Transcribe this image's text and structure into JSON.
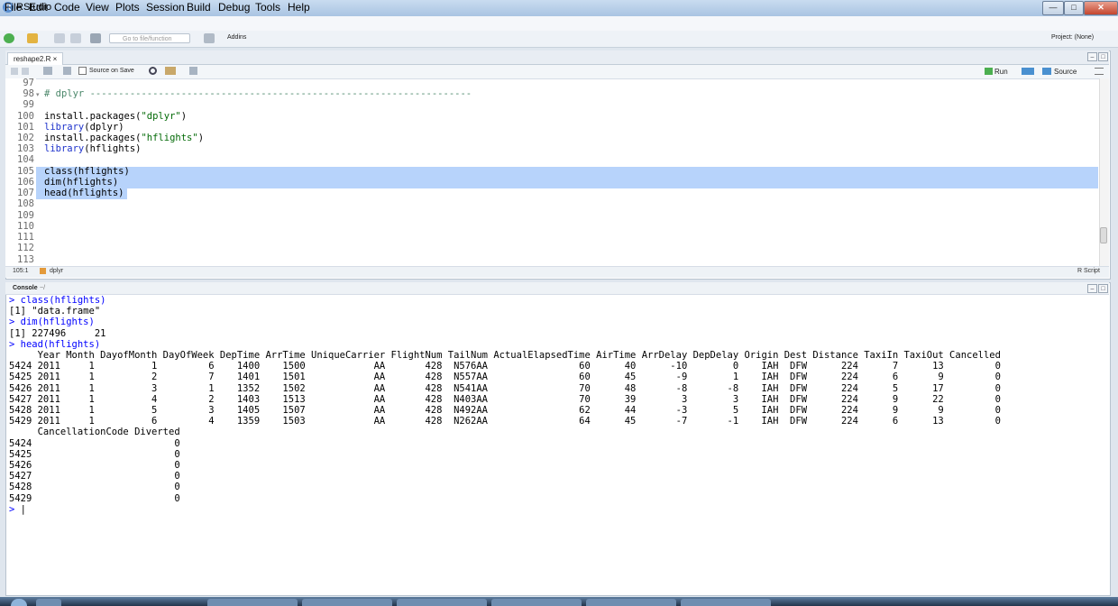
{
  "window": {
    "title": "RStudio"
  },
  "menu": [
    "File",
    "Edit",
    "Code",
    "View",
    "Plots",
    "Session",
    "Build",
    "Debug",
    "Tools",
    "Help"
  ],
  "toolbar": {
    "goto_placeholder": "Go to file/function",
    "addins": "Addins",
    "project": "Project: (None)"
  },
  "editor": {
    "tab": "reshape2.R",
    "source_on_save": "Source on Save",
    "run": "Run",
    "source": "Source",
    "line_numbers": [
      "97",
      "98",
      "99",
      "100",
      "101",
      "102",
      "103",
      "104",
      "105",
      "106",
      "107",
      "108",
      "109",
      "110",
      "111",
      "112",
      "113"
    ],
    "lines": {
      "l98": "# dplyr -------------------------------------------------------------------",
      "l100a": "install.packages(",
      "l100b": "\"dplyr\"",
      "l100c": ")",
      "l101a": "library",
      "l101b": "(dplyr)",
      "l102a": "install.packages(",
      "l102b": "\"hflights\"",
      "l102c": ")",
      "l103a": "library",
      "l103b": "(hflights)",
      "l105": "class(hflights)",
      "l106": "dim(hflights)",
      "l107": "head(hflights)"
    },
    "cursor_position": "105:1",
    "scope": "dplyr",
    "file_type": "R Script"
  },
  "console": {
    "title": "Console",
    "path": "~/",
    "cmd1": "> class(hflights)",
    "out1": "[1] \"data.frame\"",
    "cmd2": "> dim(hflights)",
    "out2": "[1] 227496     21",
    "cmd3": "> head(hflights)",
    "table_header": "     Year Month DayofMonth DayOfWeek DepTime ArrTime UniqueCarrier FlightNum TailNum ActualElapsedTime AirTime ArrDelay DepDelay Origin Dest Distance TaxiIn TaxiOut Cancelled",
    "rows": [
      "5424 2011     1          1         6    1400    1500            AA       428  N576AA                60      40      -10        0    IAH  DFW      224      7      13         0",
      "5425 2011     1          2         7    1401    1501            AA       428  N557AA                60      45       -9        1    IAH  DFW      224      6       9         0",
      "5426 2011     1          3         1    1352    1502            AA       428  N541AA                70      48       -8       -8    IAH  DFW      224      5      17         0",
      "5427 2011     1          4         2    1403    1513            AA       428  N403AA                70      39        3        3    IAH  DFW      224      9      22         0",
      "5428 2011     1          5         3    1405    1507            AA       428  N492AA                62      44       -3        5    IAH  DFW      224      9       9         0",
      "5429 2011     1          6         4    1359    1503            AA       428  N262AA                64      45       -7       -1    IAH  DFW      224      6      13         0"
    ],
    "table2_header": "     CancellationCode Diverted",
    "rows2": [
      "5424                         0",
      "5425                         0",
      "5426                         0",
      "5427                         0",
      "5428                         0",
      "5429                         0"
    ],
    "prompt": ">"
  }
}
